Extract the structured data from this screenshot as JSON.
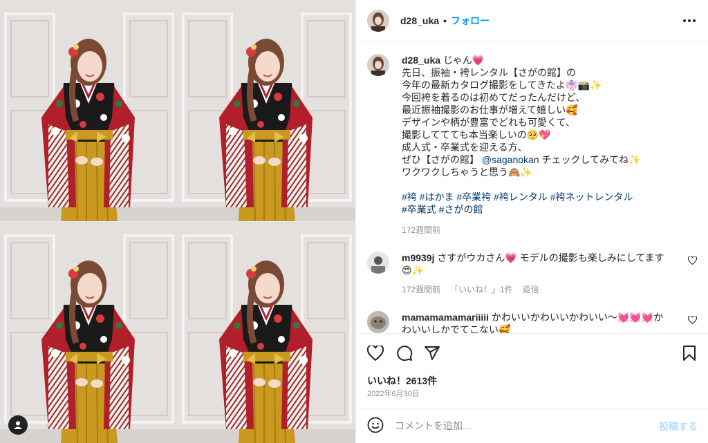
{
  "post": {
    "username": "d28_uka",
    "follow_label": "フォロー",
    "more_icon": "more-horizontal-icon"
  },
  "caption": {
    "username": "d28_uka",
    "lines": [
      "じゃん💗",
      "先日、振袖・袴レンタル【さがの館】の",
      "今年の最新カタログ撮影をしてきたよ👘📸✨",
      "今回袴を着るのは初めてだったんだけど、",
      "最近振袖撮影のお仕事が増えて嬉しい🥰",
      "デザインや柄が豊富でどれも可愛くて、",
      "撮影しててても本当楽しいの🥺💖",
      "成人式・卒業式を迎える方、"
    ],
    "line9_prefix": "ぜひ【さがの館】",
    "mention": "@saganokan",
    "line9_suffix": "チェックしてみてね✨",
    "line10": "ワクワクしちゃうと思う🙈✨",
    "hashtags_line1": "#袴 #はかま #卒業袴 #袴レンタル #袴ネットレンタル",
    "hashtags_line2": "#卒業式 #さがの館",
    "time": "172週間前"
  },
  "comments": [
    {
      "username": "m9939j",
      "text_line1": "さすがウカさん💗 モデルの撮影も楽しみにしてます",
      "text_line2": "😍✨",
      "time": "172週間前",
      "likes": "「いいね！」1件",
      "reply": "返信"
    },
    {
      "username": "mamamamamariiiii",
      "text_line1": "かわいいかわいいかわいい〜💓💓💓か",
      "text_line2": "わいいしかでてこない🥰"
    }
  ],
  "actions": {
    "like_icon": "heart-icon",
    "comment_icon": "comment-icon",
    "share_icon": "share-icon",
    "save_icon": "bookmark-icon"
  },
  "likes_text": "いいね！2613件",
  "date_text": "2022年6月30日",
  "add_comment": {
    "placeholder": "コメントを追加...",
    "post_label": "投稿する"
  },
  "colors": {
    "link_blue": "#0095f6",
    "hashtag_blue": "#00376b",
    "muted": "#8e8e8e",
    "post_disabled": "#b2dffc"
  }
}
